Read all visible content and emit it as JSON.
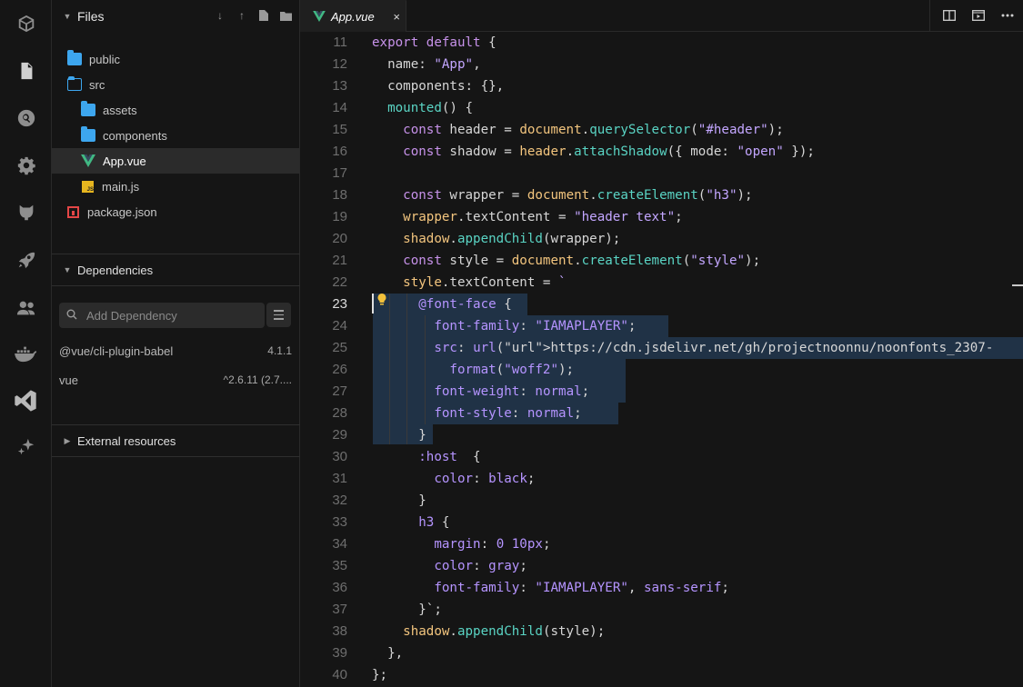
{
  "activity": {
    "icons": [
      "cube-icon",
      "file-icon",
      "search-icon",
      "gear-icon",
      "github-icon",
      "rocket-icon",
      "users-icon",
      "docker-icon",
      "vscode-icon",
      "sparkle-icon"
    ]
  },
  "sidebar": {
    "files_title": "Files",
    "tree": [
      {
        "name": "public",
        "type": "folder"
      },
      {
        "name": "src",
        "type": "folder-open"
      },
      {
        "name": "assets",
        "type": "folder"
      },
      {
        "name": "components",
        "type": "folder"
      },
      {
        "name": "App.vue",
        "type": "vue",
        "selected": true
      },
      {
        "name": "main.js",
        "type": "js"
      },
      {
        "name": "package.json",
        "type": "pkg"
      }
    ],
    "dependencies_title": "Dependencies",
    "add_dependency_placeholder": "Add Dependency",
    "dependencies": [
      {
        "name": "@vue/cli-plugin-babel",
        "version": "4.1.1"
      },
      {
        "name": "vue",
        "version": "^2.6.11 (2.7...."
      }
    ],
    "external_title": "External resources"
  },
  "editor": {
    "tab_label": "App.vue",
    "tab_close": "×",
    "current_line": 23,
    "lines": [
      {
        "n": 11,
        "text": "export default {"
      },
      {
        "n": 12,
        "text": "  name: \"App\","
      },
      {
        "n": 13,
        "text": "  components: {},"
      },
      {
        "n": 14,
        "text": "  mounted() {"
      },
      {
        "n": 15,
        "text": "    const header = document.querySelector(\"#header\");"
      },
      {
        "n": 16,
        "text": "    const shadow = header.attachShadow({ mode: \"open\" });"
      },
      {
        "n": 17,
        "text": ""
      },
      {
        "n": 18,
        "text": "    const wrapper = document.createElement(\"h3\");"
      },
      {
        "n": 19,
        "text": "    wrapper.textContent = \"header text\";"
      },
      {
        "n": 20,
        "text": "    shadow.appendChild(wrapper);"
      },
      {
        "n": 21,
        "text": "    const style = document.createElement(\"style\");"
      },
      {
        "n": 22,
        "text": "    style.textContent = `"
      },
      {
        "n": 23,
        "text": "      @font-face {"
      },
      {
        "n": 24,
        "text": "        font-family: \"IAMAPLAYER\";"
      },
      {
        "n": 25,
        "text": "        src: url(\"https://cdn.jsdelivr.net/gh/projectnoonnu/noonfonts_2307-"
      },
      {
        "n": 26,
        "text": "          format(\"woff2\");"
      },
      {
        "n": 27,
        "text": "        font-weight: normal;"
      },
      {
        "n": 28,
        "text": "        font-style: normal;"
      },
      {
        "n": 29,
        "text": "      }"
      },
      {
        "n": 30,
        "text": "      :host  {"
      },
      {
        "n": 31,
        "text": "        color: black;"
      },
      {
        "n": 32,
        "text": "      }"
      },
      {
        "n": 33,
        "text": "      h3 {"
      },
      {
        "n": 34,
        "text": "        margin: 0 10px;"
      },
      {
        "n": 35,
        "text": "        color: gray;"
      },
      {
        "n": 36,
        "text": "        font-family: \"IAMAPLAYER\", sans-serif;"
      },
      {
        "n": 37,
        "text": "      }`;"
      },
      {
        "n": 38,
        "text": "    shadow.appendChild(style);"
      },
      {
        "n": 39,
        "text": "  },"
      },
      {
        "n": 40,
        "text": "};"
      }
    ]
  },
  "colors": {
    "accent": "#3da6ee",
    "selection": "#203246",
    "vue_green": "#41b883"
  }
}
